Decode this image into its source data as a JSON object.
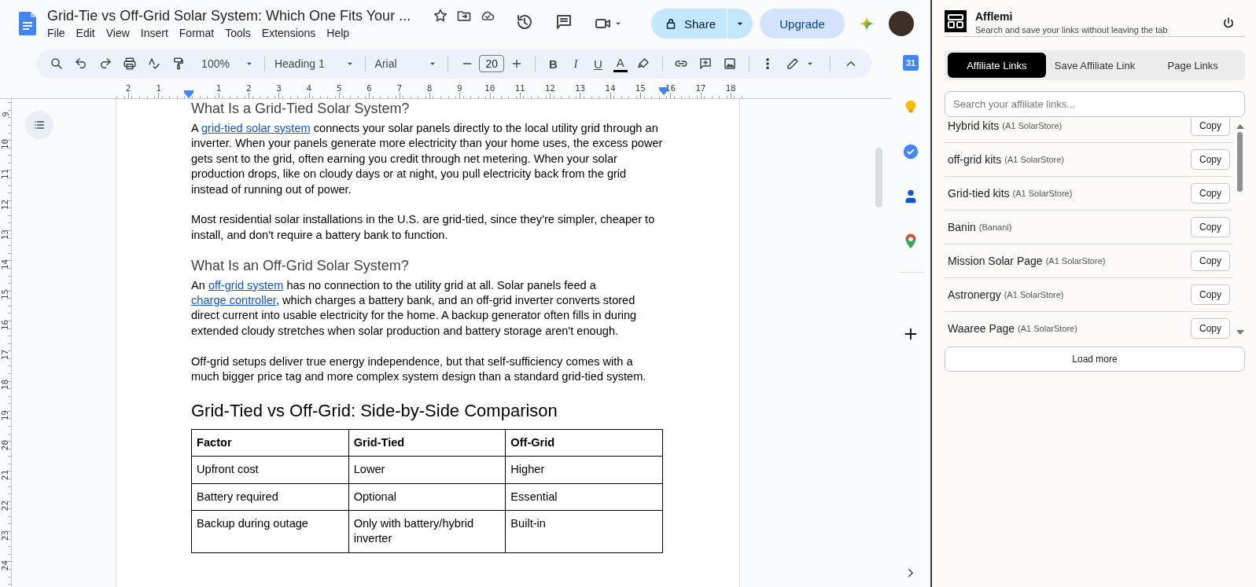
{
  "doc": {
    "title": "Grid-Tie vs Off-Grid Solar System: Which One Fits Your ...",
    "menus": [
      "File",
      "Edit",
      "View",
      "Insert",
      "Format",
      "Tools",
      "Extensions",
      "Help"
    ]
  },
  "header": {
    "share": "Share",
    "upgrade": "Upgrade"
  },
  "toolbar": {
    "zoom": "100%",
    "style": "Heading 1",
    "font": "Arial",
    "font_size": "20",
    "format": [
      "B",
      "I",
      "U",
      "A"
    ]
  },
  "ruler": {
    "before": [
      "2",
      "1"
    ],
    "after": [
      "1",
      "2",
      "3",
      "4",
      "5",
      "6",
      "7",
      "8",
      "9",
      "10",
      "11",
      "12",
      "13",
      "14",
      "15",
      "16",
      "17",
      "18"
    ]
  },
  "vertical_ruler": [
    "9",
    "10",
    "11",
    "12",
    "13",
    "14",
    "15",
    "16",
    "17",
    "18",
    "19",
    "20",
    "21",
    "22",
    "23",
    "24"
  ],
  "rail": {
    "calendar": "31"
  },
  "document": {
    "blocks": [
      {
        "kind": "h2",
        "text": "What Is a Grid-Tied Solar System?"
      },
      {
        "kind": "p",
        "parts": [
          {
            "kind": "text",
            "text": "A "
          },
          {
            "kind": "link",
            "text": "grid-tied solar system"
          },
          {
            "kind": "text",
            "text": " connects your solar panels directly to the local utility grid through an inverter. When your panels generate more electricity than your home uses, the excess power gets sent to the grid, often earning you credit through net metering. When your solar production drops, like on cloudy days or at night, you pull electricity back from the grid instead of running out of power."
          }
        ]
      },
      {
        "kind": "p",
        "parts": [
          {
            "kind": "text",
            "text": "Most residential solar installations in the U.S. are grid-tied, since they're simpler, cheaper to install, and don't require a battery bank to function."
          }
        ]
      },
      {
        "kind": "h2",
        "text": "What Is an Off-Grid Solar System?"
      },
      {
        "kind": "p",
        "parts": [
          {
            "kind": "text",
            "text": "An "
          },
          {
            "kind": "link",
            "text": "off-grid system"
          },
          {
            "kind": "text",
            "text": " has no connection to the utility grid at all. Solar panels feed a "
          },
          {
            "kind": "link",
            "text": "charge controller"
          },
          {
            "kind": "text",
            "text": ", which charges a battery bank, and an off-grid inverter converts stored direct current into usable electricity for the home. A backup generator often fills in during extended cloudy stretches when solar production and battery storage aren't enough."
          }
        ]
      },
      {
        "kind": "p",
        "parts": [
          {
            "kind": "text",
            "text": "Off-grid setups deliver true energy independence, but that self-sufficiency comes with a much bigger price tag and more complex system design than a standard grid-tied system."
          }
        ]
      },
      {
        "kind": "h1",
        "text": "Grid-Tied vs Off-Grid: Side-by-Side Comparison"
      }
    ],
    "table": {
      "columns": [
        "Factor",
        "Grid-Tied",
        "Off-Grid"
      ],
      "rows": [
        [
          "Upfront cost",
          "Lower",
          "Higher"
        ],
        [
          "Battery required",
          "Optional",
          "Essential"
        ],
        [
          "Backup during outage",
          "Only with battery/hybrid inverter",
          "Built-in"
        ]
      ]
    }
  },
  "panel": {
    "title": "Afflemi",
    "subtitle": "Search and save your links without leaving the tab",
    "tabs": [
      {
        "label": "Affiliate Links",
        "selected": true
      },
      {
        "label": "Save Affiliate Link",
        "selected": false
      },
      {
        "label": "Page Links",
        "selected": false
      }
    ],
    "search": {
      "placeholder": "Search your affiliate links..."
    },
    "links": [
      {
        "name": "Hybrid kits",
        "store": "(A1 SolarStore)",
        "button": "Copy"
      },
      {
        "name": "off-grid kits",
        "store": "(A1 SolarStore)",
        "button": "Copy"
      },
      {
        "name": "Grid-tied kits",
        "store": "(A1 SolarStore)",
        "button": "Copy"
      },
      {
        "name": "Banin",
        "store": "(Banani)",
        "button": "Copy"
      },
      {
        "name": "Mission Solar Page",
        "store": "(A1 SolarStore)",
        "button": "Copy"
      },
      {
        "name": "Astronergy",
        "store": "(A1 SolarStore)",
        "button": "Copy"
      },
      {
        "name": "Waaree Page",
        "store": "(A1 SolarStore)",
        "button": "Copy"
      }
    ],
    "load_more": "Load more"
  }
}
